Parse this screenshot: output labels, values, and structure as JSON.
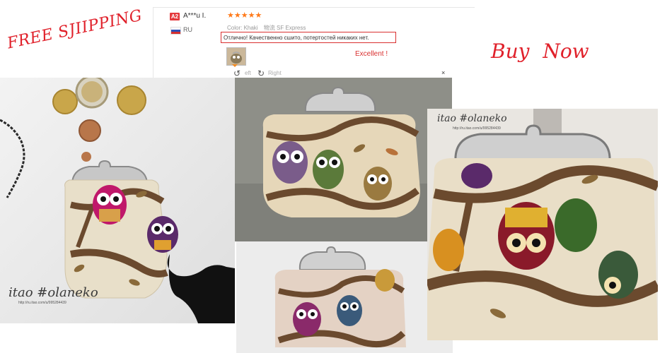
{
  "review": {
    "badge": "A2",
    "user": "A***u I.",
    "country": "RU",
    "stars": "★★★★★",
    "color_label": "Color: Khaki",
    "shipping": "物流 SF Express",
    "comment": "Отлично! Качественно сшито, потертостей никаких нет.",
    "translation": "Excellent !",
    "rotate_left_label": "eft",
    "rotate_right_label": "Right",
    "close_symbol": "×"
  },
  "promo": {
    "free_shipping": "FREE SJIIPPING",
    "buy_now": "Buy Now"
  },
  "watermarks": {
    "left": "itao #olaneko",
    "left_url": "http://ru.itao.com/u/995284439",
    "right": "itao #olaneko",
    "right_url": "http://ru.itao.com/u/995284439"
  },
  "colors": {
    "accent_red": "#e0202a",
    "star_orange": "#ff7a1a"
  }
}
